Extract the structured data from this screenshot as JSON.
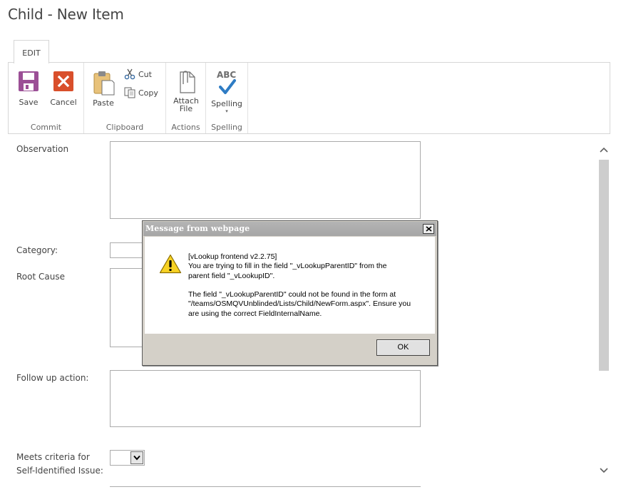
{
  "page": {
    "title": "Child - New Item"
  },
  "ribbon": {
    "tab_label": "EDIT",
    "groups": {
      "commit": {
        "label": "Commit",
        "save": "Save",
        "cancel": "Cancel"
      },
      "clipboard": {
        "label": "Clipboard",
        "paste": "Paste",
        "cut": "Cut",
        "copy": "Copy"
      },
      "actions": {
        "label": "Actions",
        "attach_line1": "Attach",
        "attach_line2": "File"
      },
      "spelling": {
        "label": "Spelling",
        "spelling": "Spelling",
        "abc": "ABC"
      }
    }
  },
  "form": {
    "observation_label": "Observation",
    "category_label": "Category:",
    "root_cause_label": "Root Cause",
    "follow_up_label": "Follow up action:",
    "meets_criteria_line1": "Meets criteria for",
    "meets_criteria_line2": "Self-Identified Issue:",
    "meets_criteria_value": ""
  },
  "dialog": {
    "title": "Message from webpage",
    "message": "[vLookup frontend v2.2.75]\nYou are trying to fill in the field \"_vLookupParentID\" from the\nparent field \"_vLookupID\".\n\nThe field \"_vLookupParentID\" could not be found in the form at\n\"/teams/OSMQVUnblinded/Lists/Child/NewForm.aspx\". Ensure you\nare using the correct FieldInternalName.",
    "ok_label": "OK"
  },
  "icons": {
    "save": "save-icon",
    "cancel": "cancel-icon",
    "paste": "paste-icon",
    "cut": "scissors-icon",
    "copy": "copy-icon",
    "attach": "paperclip-file-icon",
    "spelling": "abc-checkmark-icon",
    "warning": "warning-icon",
    "close": "close-icon"
  },
  "colors": {
    "save_purple": "#9b4f96",
    "cancel_red": "#d94f2b",
    "spell_blue": "#2e7cc4",
    "warning_yellow": "#f7d224"
  }
}
